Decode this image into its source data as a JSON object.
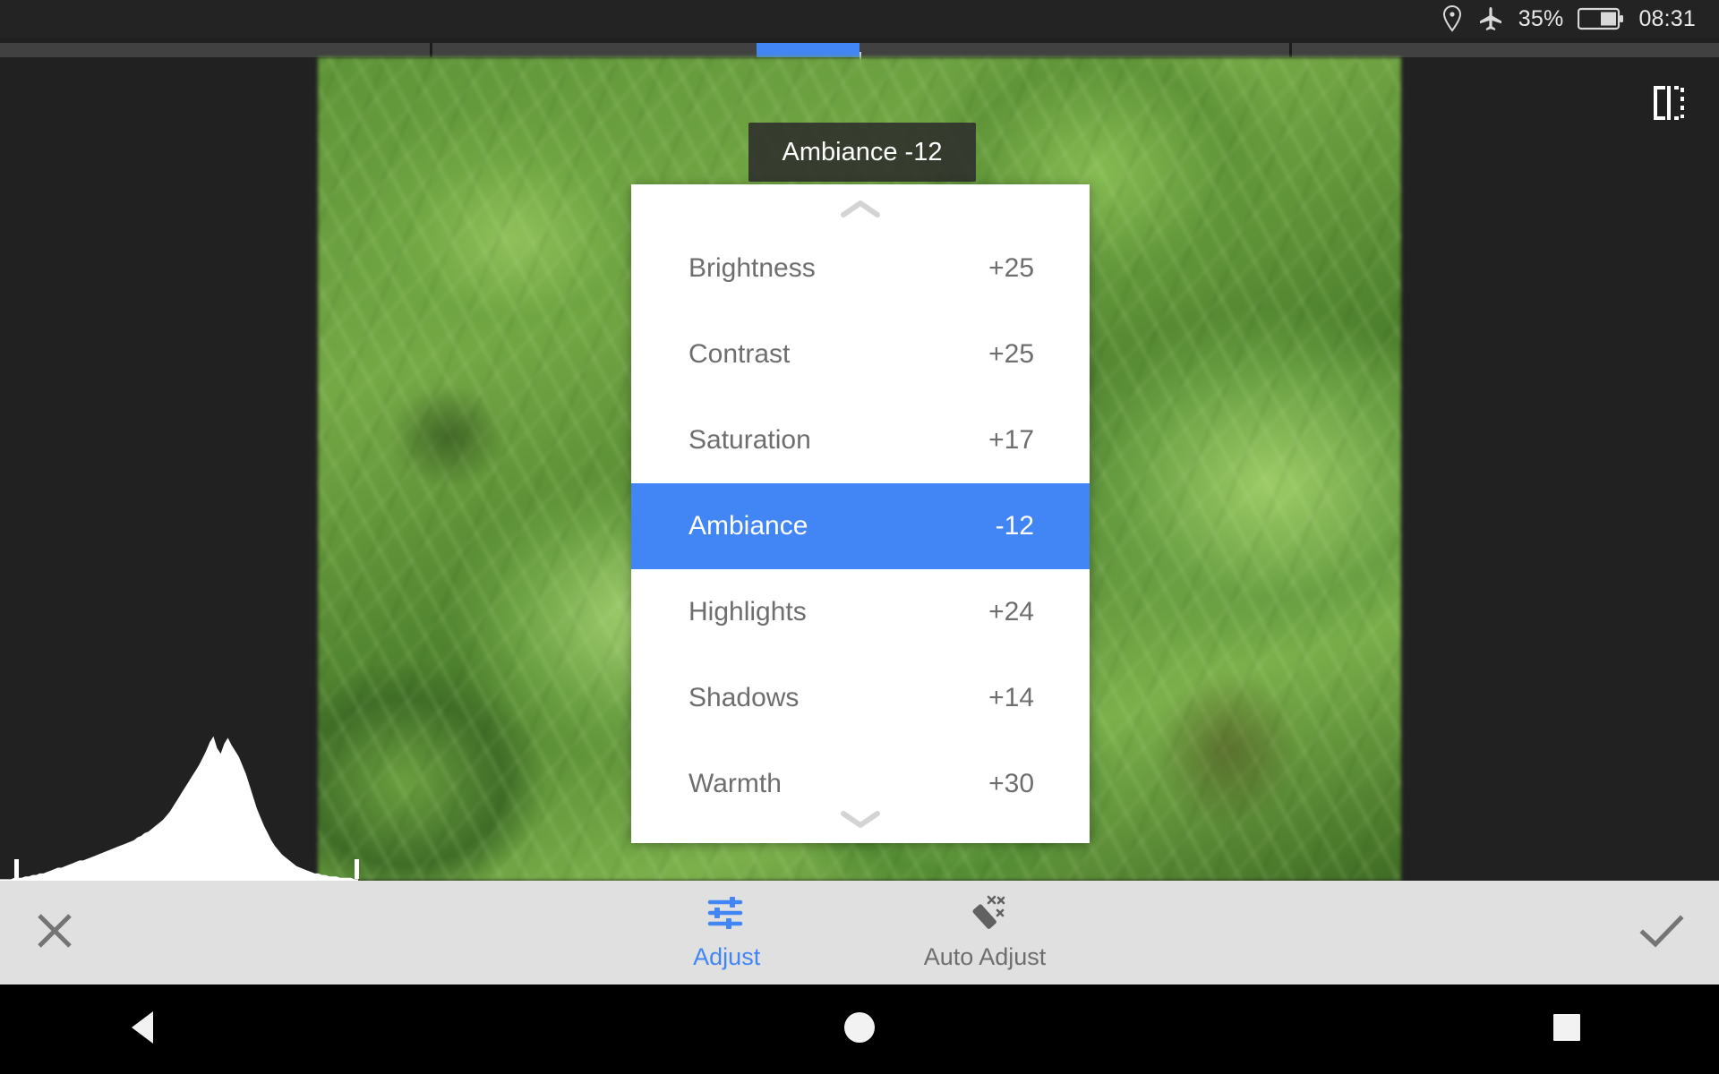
{
  "status_bar": {
    "location_icon": "location-pin-icon",
    "airplane_icon": "airplane-mode-icon",
    "battery_percent": "35%",
    "battery_icon": "battery-icon",
    "time": "08:31"
  },
  "editor": {
    "compare_icon": "compare-before-after-icon",
    "slider": {
      "name": "adjustment-slider",
      "fill_start_pct": 44.0,
      "fill_end_pct": 50.0,
      "ticks_pct": [
        25,
        75
      ],
      "handle_pct": 50.0,
      "track_color": "#414141",
      "fill_color": "#4285f4"
    },
    "histogram": {
      "name": "histogram",
      "fill_color": "#ffffff",
      "background_color": "#212121",
      "values": [
        1,
        1,
        1,
        1,
        2,
        2,
        2,
        3,
        3,
        4,
        4,
        5,
        5,
        6,
        7,
        8,
        9,
        9,
        10,
        11,
        12,
        13,
        14,
        14,
        15,
        16,
        17,
        18,
        19,
        20,
        21,
        22,
        23,
        24,
        25,
        26,
        27,
        28,
        30,
        31,
        33,
        34,
        36,
        38,
        40,
        42,
        45,
        48,
        52,
        56,
        60,
        64,
        68,
        72,
        76,
        80,
        85,
        90,
        96,
        100,
        92,
        88,
        95,
        99,
        94,
        90,
        86,
        80,
        74,
        66,
        58,
        50,
        44,
        38,
        33,
        28,
        24,
        21,
        18,
        16,
        14,
        12,
        10,
        9,
        8,
        7,
        6,
        5,
        5,
        4,
        4,
        3,
        3,
        3,
        2,
        2,
        2,
        2,
        1,
        1
      ]
    },
    "tooltip": {
      "text": "Ambiance -12"
    }
  },
  "panel": {
    "name": "adjustment-menu",
    "scroll_up_icon": "chevron-up-icon",
    "scroll_down_icon": "chevron-down-icon",
    "selected_index": 3,
    "accent_color": "#4285f4",
    "items": [
      {
        "label": "Brightness",
        "value": "+25"
      },
      {
        "label": "Contrast",
        "value": "+25"
      },
      {
        "label": "Saturation",
        "value": "+17"
      },
      {
        "label": "Ambiance",
        "value": "-12"
      },
      {
        "label": "Highlights",
        "value": "+24"
      },
      {
        "label": "Shadows",
        "value": "+14"
      },
      {
        "label": "Warmth",
        "value": "+30"
      }
    ]
  },
  "toolbar": {
    "cancel_icon": "close-x-icon",
    "confirm_icon": "checkmark-icon",
    "tools": [
      {
        "label": "Adjust",
        "icon": "tune-sliders-icon",
        "active": true
      },
      {
        "label": "Auto Adjust",
        "icon": "magic-wand-icon",
        "active": false
      }
    ]
  },
  "navbar": {
    "back_icon": "nav-back-triangle-icon",
    "home_icon": "nav-home-circle-icon",
    "recents_icon": "nav-recents-square-icon"
  }
}
